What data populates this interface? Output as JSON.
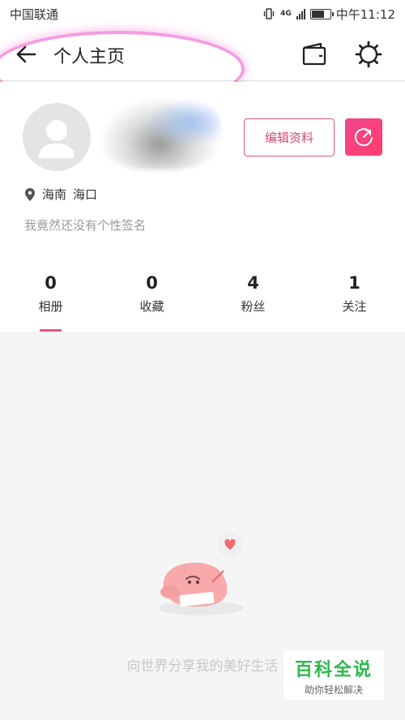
{
  "status_bar": {
    "carrier": "中国联通",
    "network": "4G",
    "time": "中午11:12",
    "battery_level": 0.65
  },
  "header": {
    "title": "个人主页",
    "icons": [
      "back-arrow-icon",
      "wallet-icon",
      "settings-icon"
    ]
  },
  "profile": {
    "edit_label": "编辑资料",
    "province": "海南",
    "city": "海口",
    "bio": "我竟然还没有个性签名"
  },
  "stats": [
    {
      "value": "0",
      "label": "相册"
    },
    {
      "value": "0",
      "label": "收藏"
    },
    {
      "value": "4",
      "label": "粉丝"
    },
    {
      "value": "1",
      "label": "关注"
    }
  ],
  "empty": {
    "message": "向世界分享我的美好生活"
  },
  "watermark": {
    "title": "百科全说",
    "subtitle": "助你轻松解决"
  },
  "colors": {
    "accent": "#e0587a",
    "highlight": "#ec48c8",
    "share_gradient": "#f0468c"
  }
}
